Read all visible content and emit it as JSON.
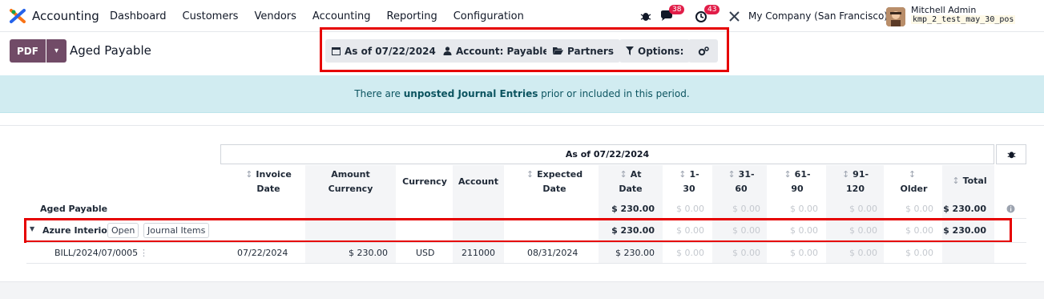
{
  "nav": {
    "app_name": "Accounting",
    "menu": [
      "Dashboard",
      "Customers",
      "Vendors",
      "Accounting",
      "Reporting",
      "Configuration"
    ],
    "messages_count": "38",
    "activities_count": "43",
    "company": "My Company (San Francisco)",
    "user_name": "Mitchell Admin",
    "db_name": "kmp_2_test_may_30_pos"
  },
  "control": {
    "pdf_label": "PDF",
    "report_title": "Aged Payable",
    "filters": {
      "as_of": "As of 07/22/2024",
      "account": "Account: Payable",
      "partners": "Partners",
      "options": "Options:"
    }
  },
  "banner": {
    "prefix": "There are ",
    "bold": "unposted Journal Entries",
    "suffix": " prior or included in this period."
  },
  "table": {
    "period_header": "As of 07/22/2024",
    "columns": {
      "invoice_date": [
        "Invoice",
        "Date"
      ],
      "amount_currency": [
        "Amount",
        "Currency"
      ],
      "currency": "Currency",
      "account": "Account",
      "expected_date": [
        "Expected",
        "Date"
      ],
      "at_date": [
        "At",
        "Date"
      ],
      "d1_30": [
        "1-",
        "30"
      ],
      "d31_60": [
        "31-",
        "60"
      ],
      "d61_90": [
        "61-",
        "90"
      ],
      "d91_120": [
        "91-",
        "120"
      ],
      "older": "Older",
      "total": "Total"
    },
    "total_row": {
      "label": "Aged Payable",
      "at_date": "$ 230.00",
      "d1_30": "$ 0.00",
      "d31_60": "$ 0.00",
      "d61_90": "$ 0.00",
      "d91_120": "$ 0.00",
      "older": "$ 0.00",
      "total": "$ 230.00"
    },
    "partner_row": {
      "name": "Azure Interior",
      "open_label": "Open",
      "journal_label": "Journal Items",
      "at_date": "$ 230.00",
      "d1_30": "$ 0.00",
      "d31_60": "$ 0.00",
      "d61_90": "$ 0.00",
      "d91_120": "$ 0.00",
      "older": "$ 0.00",
      "total": "$ 230.00"
    },
    "line_row": {
      "name": "BILL/2024/07/0005",
      "invoice_date": "07/22/2024",
      "amount_currency": "$ 230.00",
      "currency": "USD",
      "account": "211000",
      "expected_date": "08/31/2024",
      "at_date": "$ 230.00",
      "d1_30": "$ 0.00",
      "d31_60": "$ 0.00",
      "d61_90": "$ 0.00",
      "d91_120": "$ 0.00",
      "older": "$ 0.00"
    }
  }
}
